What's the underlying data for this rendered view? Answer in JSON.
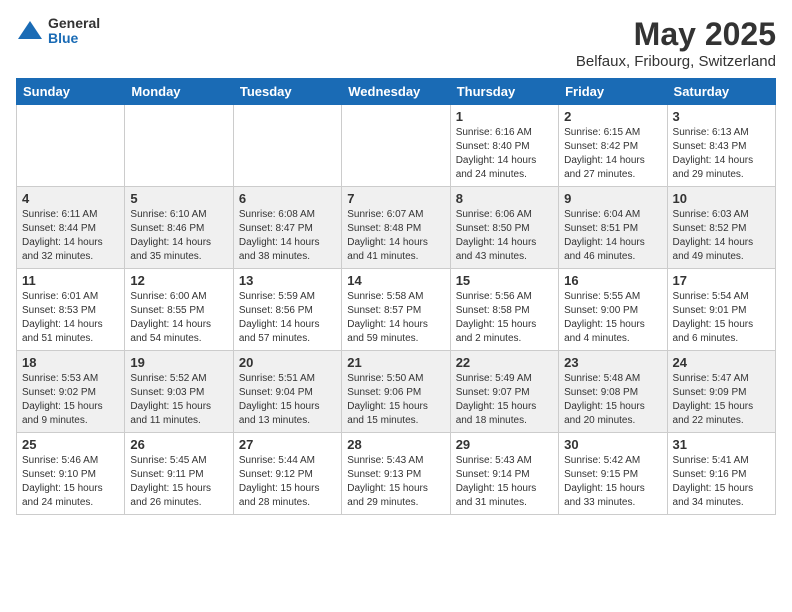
{
  "logo": {
    "general": "General",
    "blue": "Blue"
  },
  "title": "May 2025",
  "location": "Belfaux, Fribourg, Switzerland",
  "days_of_week": [
    "Sunday",
    "Monday",
    "Tuesday",
    "Wednesday",
    "Thursday",
    "Friday",
    "Saturday"
  ],
  "weeks": [
    [
      {
        "day": "",
        "info": ""
      },
      {
        "day": "",
        "info": ""
      },
      {
        "day": "",
        "info": ""
      },
      {
        "day": "",
        "info": ""
      },
      {
        "day": "1",
        "info": "Sunrise: 6:16 AM\nSunset: 8:40 PM\nDaylight: 14 hours\nand 24 minutes."
      },
      {
        "day": "2",
        "info": "Sunrise: 6:15 AM\nSunset: 8:42 PM\nDaylight: 14 hours\nand 27 minutes."
      },
      {
        "day": "3",
        "info": "Sunrise: 6:13 AM\nSunset: 8:43 PM\nDaylight: 14 hours\nand 29 minutes."
      }
    ],
    [
      {
        "day": "4",
        "info": "Sunrise: 6:11 AM\nSunset: 8:44 PM\nDaylight: 14 hours\nand 32 minutes."
      },
      {
        "day": "5",
        "info": "Sunrise: 6:10 AM\nSunset: 8:46 PM\nDaylight: 14 hours\nand 35 minutes."
      },
      {
        "day": "6",
        "info": "Sunrise: 6:08 AM\nSunset: 8:47 PM\nDaylight: 14 hours\nand 38 minutes."
      },
      {
        "day": "7",
        "info": "Sunrise: 6:07 AM\nSunset: 8:48 PM\nDaylight: 14 hours\nand 41 minutes."
      },
      {
        "day": "8",
        "info": "Sunrise: 6:06 AM\nSunset: 8:50 PM\nDaylight: 14 hours\nand 43 minutes."
      },
      {
        "day": "9",
        "info": "Sunrise: 6:04 AM\nSunset: 8:51 PM\nDaylight: 14 hours\nand 46 minutes."
      },
      {
        "day": "10",
        "info": "Sunrise: 6:03 AM\nSunset: 8:52 PM\nDaylight: 14 hours\nand 49 minutes."
      }
    ],
    [
      {
        "day": "11",
        "info": "Sunrise: 6:01 AM\nSunset: 8:53 PM\nDaylight: 14 hours\nand 51 minutes."
      },
      {
        "day": "12",
        "info": "Sunrise: 6:00 AM\nSunset: 8:55 PM\nDaylight: 14 hours\nand 54 minutes."
      },
      {
        "day": "13",
        "info": "Sunrise: 5:59 AM\nSunset: 8:56 PM\nDaylight: 14 hours\nand 57 minutes."
      },
      {
        "day": "14",
        "info": "Sunrise: 5:58 AM\nSunset: 8:57 PM\nDaylight: 14 hours\nand 59 minutes."
      },
      {
        "day": "15",
        "info": "Sunrise: 5:56 AM\nSunset: 8:58 PM\nDaylight: 15 hours\nand 2 minutes."
      },
      {
        "day": "16",
        "info": "Sunrise: 5:55 AM\nSunset: 9:00 PM\nDaylight: 15 hours\nand 4 minutes."
      },
      {
        "day": "17",
        "info": "Sunrise: 5:54 AM\nSunset: 9:01 PM\nDaylight: 15 hours\nand 6 minutes."
      }
    ],
    [
      {
        "day": "18",
        "info": "Sunrise: 5:53 AM\nSunset: 9:02 PM\nDaylight: 15 hours\nand 9 minutes."
      },
      {
        "day": "19",
        "info": "Sunrise: 5:52 AM\nSunset: 9:03 PM\nDaylight: 15 hours\nand 11 minutes."
      },
      {
        "day": "20",
        "info": "Sunrise: 5:51 AM\nSunset: 9:04 PM\nDaylight: 15 hours\nand 13 minutes."
      },
      {
        "day": "21",
        "info": "Sunrise: 5:50 AM\nSunset: 9:06 PM\nDaylight: 15 hours\nand 15 minutes."
      },
      {
        "day": "22",
        "info": "Sunrise: 5:49 AM\nSunset: 9:07 PM\nDaylight: 15 hours\nand 18 minutes."
      },
      {
        "day": "23",
        "info": "Sunrise: 5:48 AM\nSunset: 9:08 PM\nDaylight: 15 hours\nand 20 minutes."
      },
      {
        "day": "24",
        "info": "Sunrise: 5:47 AM\nSunset: 9:09 PM\nDaylight: 15 hours\nand 22 minutes."
      }
    ],
    [
      {
        "day": "25",
        "info": "Sunrise: 5:46 AM\nSunset: 9:10 PM\nDaylight: 15 hours\nand 24 minutes."
      },
      {
        "day": "26",
        "info": "Sunrise: 5:45 AM\nSunset: 9:11 PM\nDaylight: 15 hours\nand 26 minutes."
      },
      {
        "day": "27",
        "info": "Sunrise: 5:44 AM\nSunset: 9:12 PM\nDaylight: 15 hours\nand 28 minutes."
      },
      {
        "day": "28",
        "info": "Sunrise: 5:43 AM\nSunset: 9:13 PM\nDaylight: 15 hours\nand 29 minutes."
      },
      {
        "day": "29",
        "info": "Sunrise: 5:43 AM\nSunset: 9:14 PM\nDaylight: 15 hours\nand 31 minutes."
      },
      {
        "day": "30",
        "info": "Sunrise: 5:42 AM\nSunset: 9:15 PM\nDaylight: 15 hours\nand 33 minutes."
      },
      {
        "day": "31",
        "info": "Sunrise: 5:41 AM\nSunset: 9:16 PM\nDaylight: 15 hours\nand 34 minutes."
      }
    ]
  ]
}
